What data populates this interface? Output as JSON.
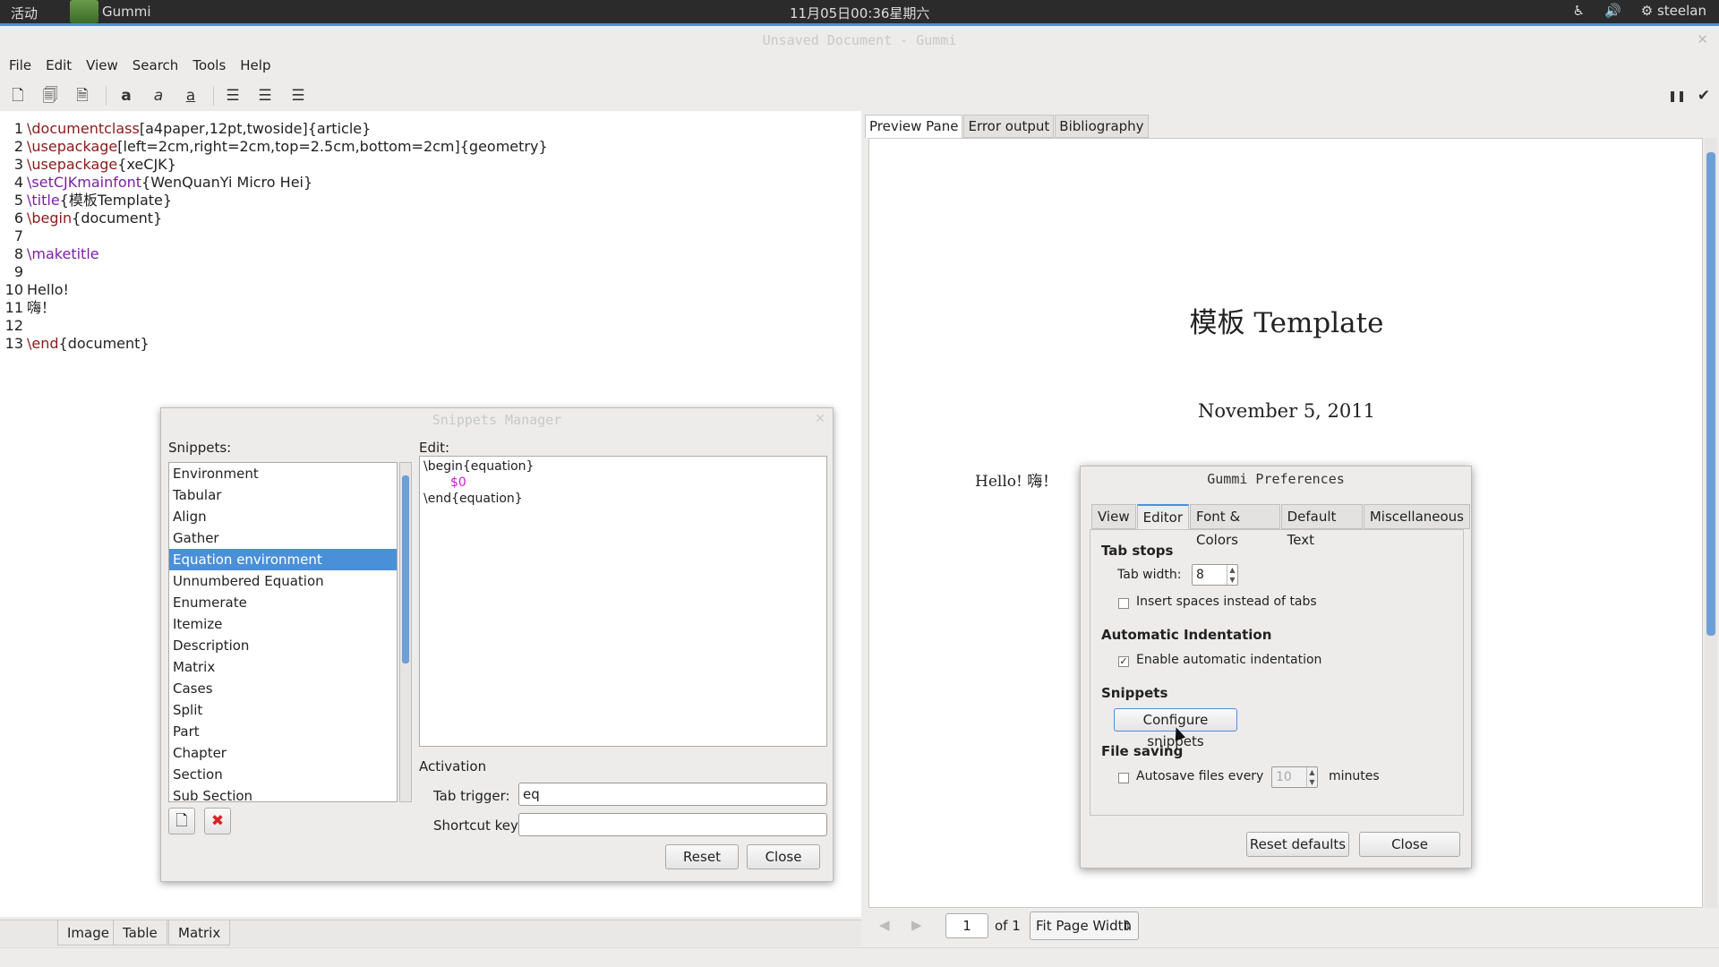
{
  "topbar": {
    "activities": "活动",
    "app_name": "Gummi",
    "clock": "11月05日00:36星期六",
    "user": "steelan"
  },
  "window": {
    "title": "Unsaved Document - Gummi"
  },
  "menu": [
    "File",
    "Edit",
    "View",
    "Search",
    "Tools",
    "Help"
  ],
  "editor": {
    "lines": [
      {
        "n": "1",
        "cmd": "\\documentclass",
        "rest": "[a4paper,12pt,twoside]{article}"
      },
      {
        "n": "2",
        "cmd": "\\usepackage",
        "rest": "[left=2cm,right=2cm,top=2.5cm,bottom=2cm]{geometry}"
      },
      {
        "n": "3",
        "cmd": "\\usepackage",
        "rest": "{xeCJK}"
      },
      {
        "n": "4",
        "cmd": "\\setCJKmainfont",
        "rest": "{WenQuanYi Micro Hei}"
      },
      {
        "n": "5",
        "cmd": "\\title",
        "rest": "{模板Template}"
      },
      {
        "n": "6",
        "cmd": "\\begin",
        "rest": "{document}"
      },
      {
        "n": "7",
        "cmd": "",
        "rest": ""
      },
      {
        "n": "8",
        "cmd": "\\maketitle",
        "rest": ""
      },
      {
        "n": "9",
        "cmd": "",
        "rest": ""
      },
      {
        "n": "10",
        "cmd": "",
        "rest": "Hello!"
      },
      {
        "n": "11",
        "cmd": "",
        "rest": "嗨！"
      },
      {
        "n": "12",
        "cmd": "",
        "rest": ""
      },
      {
        "n": "13",
        "cmd": "\\end",
        "rest": "{document}"
      }
    ]
  },
  "bottom_tabs": [
    "Image",
    "Table",
    "Matrix"
  ],
  "preview": {
    "tabs": [
      "Preview Pane",
      "Error output",
      "Bibliography"
    ],
    "doc_title": "模板 Template",
    "doc_date": "November 5, 2011",
    "doc_body": "Hello! 嗨！",
    "page_value": "1",
    "page_of": "of 1",
    "zoom": "Fit Page Width"
  },
  "snippets_manager": {
    "title": "Snippets Manager",
    "snippets_label": "Snippets:",
    "edit_label": "Edit:",
    "items": [
      "Environment",
      "Tabular",
      "Align",
      "Gather",
      "Equation environment",
      "Unnumbered Equation",
      "Enumerate",
      "Itemize",
      "Description",
      "Matrix",
      "Cases",
      "Split",
      "Part",
      "Chapter",
      "Section",
      "Sub Section"
    ],
    "selected": "Equation environment",
    "edit_line1": "\\begin{equation}",
    "edit_line2": "$0",
    "edit_line3": "\\end{equation}",
    "activation_label": "Activation",
    "tab_trigger_label": "Tab trigger:",
    "tab_trigger_value": "eq",
    "shortcut_label": "Shortcut key:",
    "shortcut_value": "",
    "reset_label": "Reset",
    "close_label": "Close"
  },
  "preferences": {
    "title": "Gummi Preferences",
    "tabs": [
      "View",
      "Editor",
      "Font & Colors",
      "Default Text",
      "Miscellaneous"
    ],
    "active_tab": "Editor",
    "tab_stops": "Tab stops",
    "tab_width_label": "Tab width:",
    "tab_width_value": "8",
    "insert_spaces": "Insert spaces instead of tabs",
    "auto_indent_section": "Automatic Indentation",
    "auto_indent": "Enable automatic indentation",
    "snippets_section": "Snippets",
    "configure_snippets": "Configure snippets",
    "file_saving": "File saving",
    "autosave_label": "Autosave files every",
    "autosave_value": "10",
    "minutes": "minutes",
    "reset_defaults": "Reset defaults",
    "close": "Close"
  }
}
